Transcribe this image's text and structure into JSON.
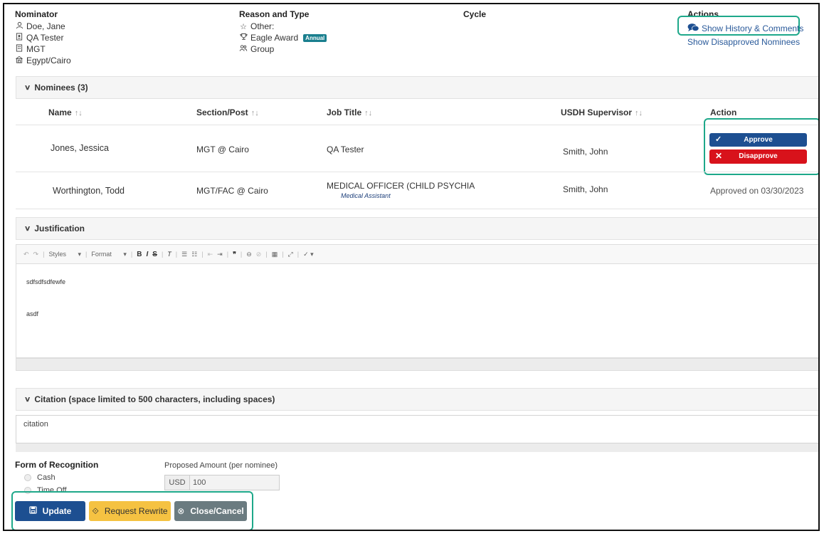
{
  "header": {
    "nominator_label": "Nominator",
    "nominator_lines": [
      "Doe, Jane",
      "QA Tester",
      "MGT",
      "Egypt/Cairo"
    ],
    "reason_label": "Reason and Type",
    "reason_lines": [
      "Other:",
      "Eagle Award",
      "Group"
    ],
    "award_badge": "Annual",
    "cycle_label": "Cycle",
    "actions_label": "Actions",
    "show_history": "Show History & Comments",
    "show_disapproved": "Show Disapproved Nominees"
  },
  "nominees": {
    "title": "Nominees (3)",
    "columns": [
      "Name",
      "Section/Post",
      "Job Title",
      "USDH Supervisor",
      "Action"
    ],
    "rows": [
      {
        "name": "Jones, Jessica",
        "section": "MGT @ Cairo",
        "job_title": "QA Tester",
        "job_subtitle": "",
        "supervisor": "Smith, John",
        "action": ""
      },
      {
        "name": "Worthington, Todd",
        "section": "MGT/FAC @ Cairo",
        "job_title": "MEDICAL OFFICER (CHILD PSYCHIA",
        "job_subtitle": "Medical Assistant",
        "supervisor": "Smith, John",
        "action": "Approved on 03/30/2023"
      }
    ],
    "approve_label": "Approve",
    "disapprove_label": "Disapprove"
  },
  "justification": {
    "title": "Justification",
    "toolbar": {
      "styles": "Styles",
      "format": "Format"
    },
    "content": [
      "sdfsdfsdfewfe",
      "asdf"
    ]
  },
  "citation": {
    "title": "Citation (space limited to 500 characters, including spaces)",
    "content": "citation"
  },
  "recognition": {
    "form_label": "Form of Recognition",
    "options": [
      "Cash",
      "Time Off"
    ],
    "amount_label": "Proposed Amount (per nominee)",
    "currency": "USD",
    "amount": "100"
  },
  "footer_buttons": {
    "update": "Update",
    "request_rewrite": "Request Rewrite",
    "close_cancel": "Close/Cancel"
  },
  "colors": {
    "primary": "#1d4f91",
    "danger": "#d8121b",
    "warning": "#f5c242",
    "secondary": "#6b7b80",
    "highlight": "#1ea88a",
    "badge": "#1a7f8e"
  }
}
